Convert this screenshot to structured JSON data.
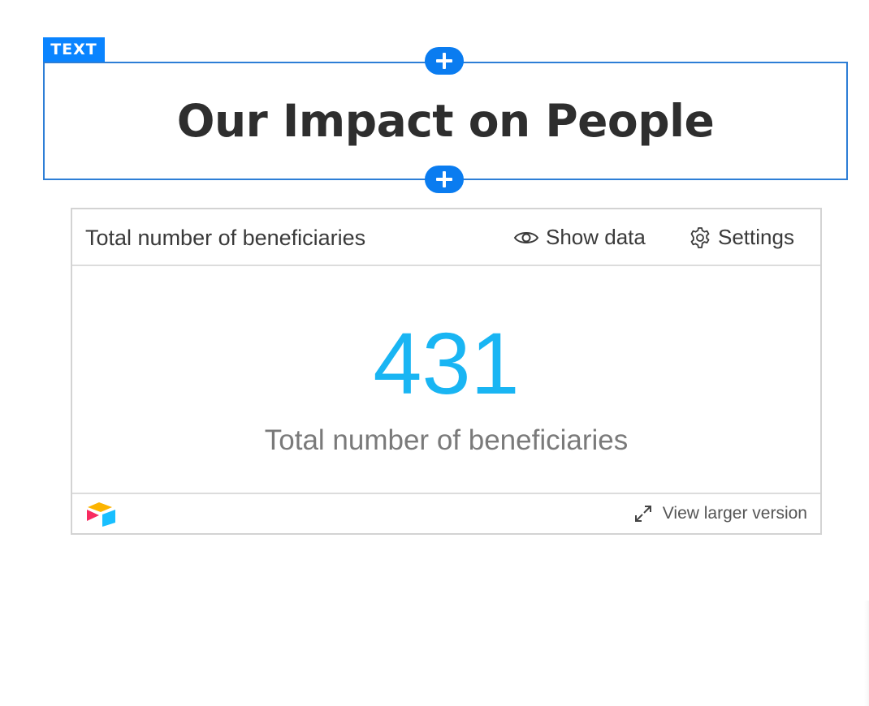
{
  "text_block": {
    "tag": "TEXT",
    "heading": "Our Impact on People"
  },
  "card": {
    "title": "Total number of beneficiaries",
    "show_data_label": "Show data",
    "settings_label": "Settings",
    "metric_value": "431",
    "metric_label": "Total number of beneficiaries",
    "view_larger_label": "View larger version"
  },
  "icons": {
    "add_top": "plus-icon",
    "add_bottom": "plus-icon",
    "show_data": "eye-icon",
    "settings": "gear-icon",
    "view_larger": "expand-icon",
    "logo": "airtable-logo"
  },
  "colors": {
    "accent_blue": "#0a84ff",
    "metric_blue": "#19b5f3",
    "heading": "#2e2e2e"
  }
}
